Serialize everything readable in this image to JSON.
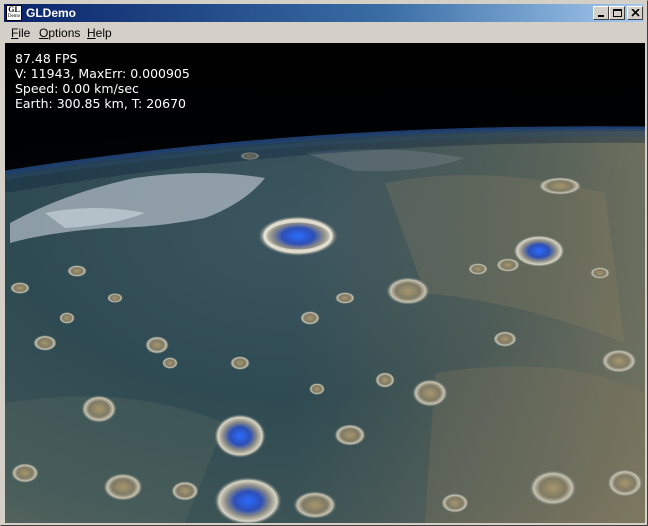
{
  "window": {
    "title": "GLDemo",
    "icon_text_top": "GL",
    "icon_text_bottom": "Demo"
  },
  "menu": {
    "file": {
      "accel": "F",
      "rest": "ile"
    },
    "options": {
      "accel": "O",
      "rest": "ptions"
    },
    "help": {
      "accel": "H",
      "rest": "elp"
    }
  },
  "hud": {
    "fps": "87.48 FPS",
    "vertices": "V: 11943, MaxErr: 0.000905",
    "speed": "Speed: 0.00 km/sec",
    "earth": "Earth: 300.85 km, T: 20670"
  },
  "colors": {
    "titlebar_start": "#0a246a",
    "titlebar_end": "#a6caf0",
    "space": "#000000",
    "atmosphere": "#1f3f70"
  }
}
